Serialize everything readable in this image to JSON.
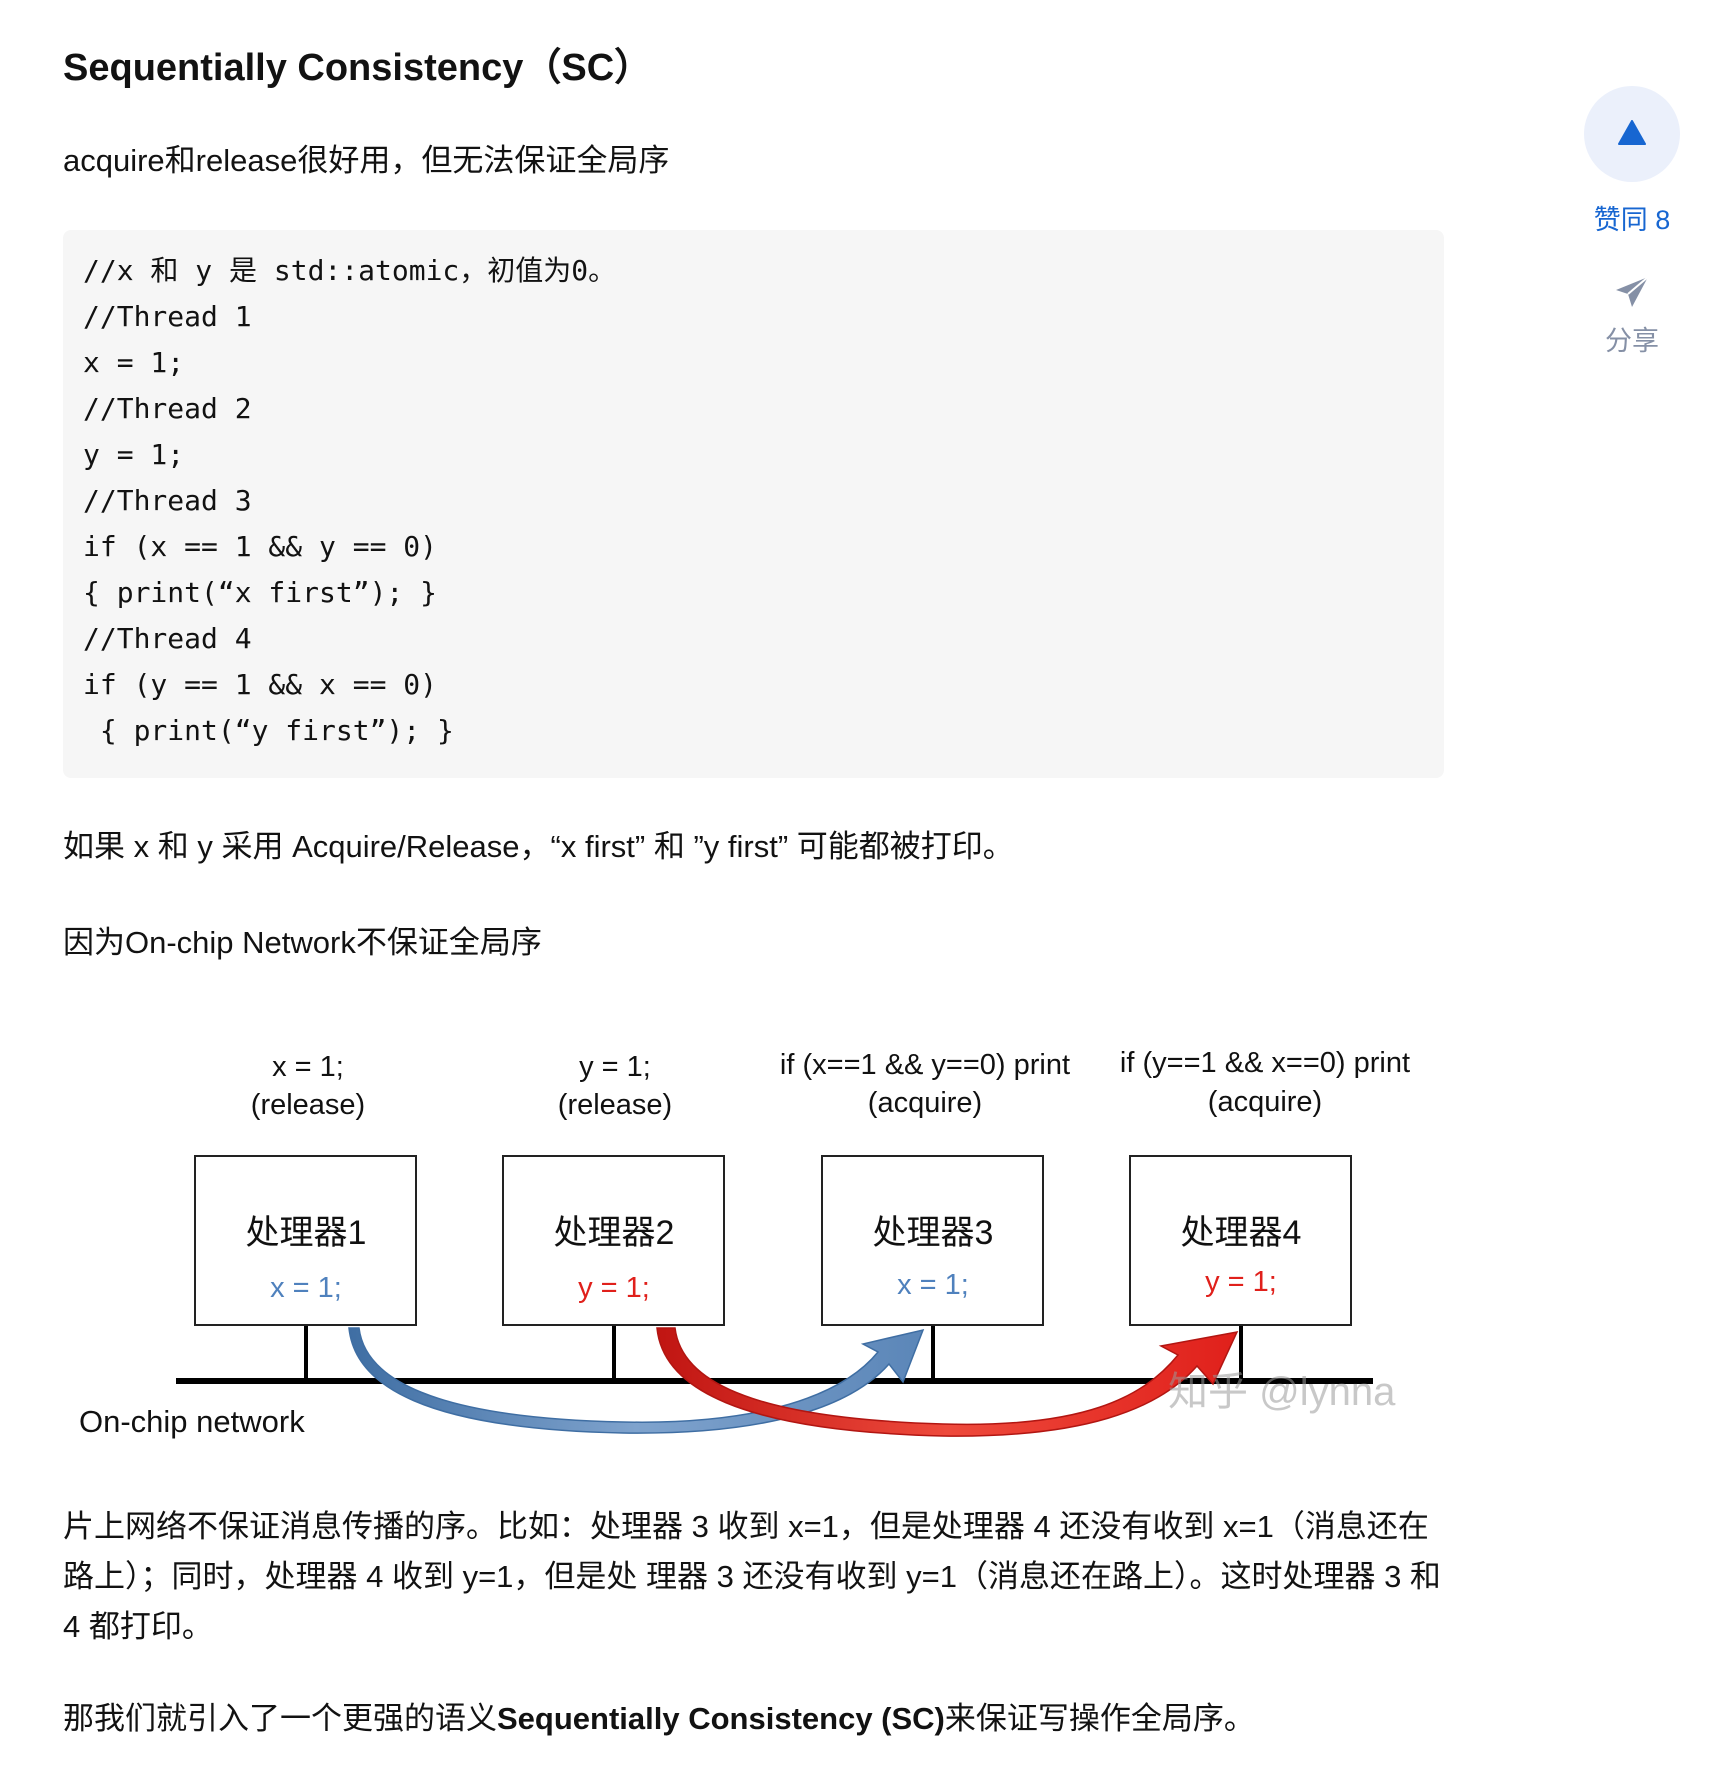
{
  "article": {
    "heading": "Sequentially Consistency（SC）",
    "intro": "acquire和release很好用，但无法保证全局序",
    "code_lines": [
      "//x 和 y 是 std::atomic，初值为0。",
      "//Thread 1",
      "x = 1;",
      "//Thread 2",
      "y = 1;",
      "//Thread 3",
      "if (x == 1 && y == 0)",
      "{ print(“x first”); }",
      "//Thread 4",
      "if (y == 1 && x == 0)",
      " { print(“y first”); }"
    ],
    "para_acq_rel": "如果 x 和 y 采用 Acquire/Release，“x first” 和 ”y first” 可能都被打印。",
    "para_reason": "因为On-chip Network不保证全局序",
    "para_explain": "片上网络不保证消息传播的序。比如：处理器 3 收到 x=1，但是处理器 4 还没有收到 x=1（消息还在路上）；同时，处理器 4 收到 y=1，但是处 理器 3 还没有收到 y=1（消息还在路上）。这时处理器 3 和 4 都打印。",
    "conclusion_prefix": "那我们就引入了一个更强的语义",
    "conclusion_strong": "Sequentially Consistency (SC)",
    "conclusion_suffix": "来保证写操作全局序。"
  },
  "diagram": {
    "processors": [
      {
        "top_line1": "x = 1;",
        "top_line2": "(release)",
        "name": "处理器1",
        "value": "x = 1;",
        "value_color": "#4f81bd"
      },
      {
        "top_line1": "y = 1;",
        "top_line2": "(release)",
        "name": "处理器2",
        "value": "y = 1;",
        "value_color": "#e0201b"
      },
      {
        "top_line1": "if (x==1 && y==0) print",
        "top_line2": "(acquire)",
        "name": "处理器3",
        "value": "x = 1;",
        "value_color": "#4f81bd"
      },
      {
        "top_line1": "if (y==1 && x==0) print",
        "top_line2": "(acquire)",
        "name": "处理器4",
        "value": "y = 1;",
        "value_color": "#e0201b"
      }
    ],
    "network_label": "On-chip network",
    "watermark": "知乎 @lynna",
    "arrow_colors": {
      "blue": "#5b86b8",
      "red": "#e0201b"
    }
  },
  "sidebar": {
    "vote_label": "赞同 8",
    "share_label": "分享",
    "vote_icon": "triangle-up-icon",
    "share_icon": "paper-plane-icon"
  }
}
